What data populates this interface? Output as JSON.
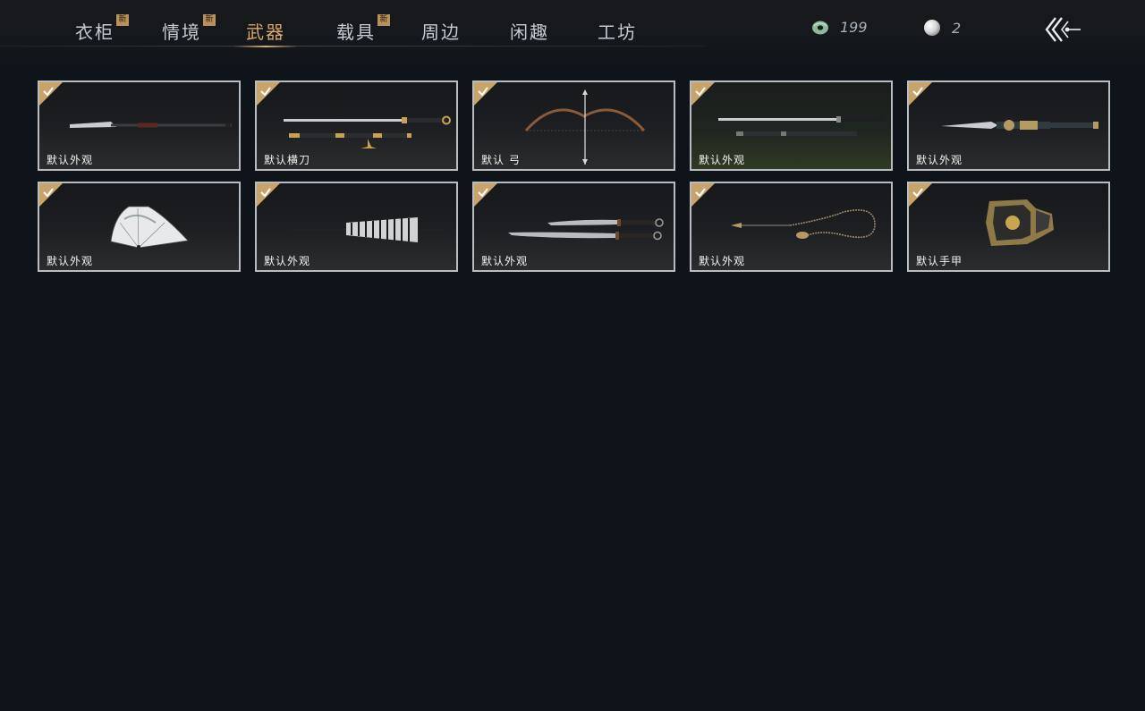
{
  "tabs": [
    {
      "label": "衣柜",
      "badge": "新"
    },
    {
      "label": "情境",
      "badge": "新"
    },
    {
      "label": "武器",
      "badge": ""
    },
    {
      "label": "载具",
      "badge": "新"
    },
    {
      "label": "周边",
      "badge": ""
    },
    {
      "label": "闲趣",
      "badge": ""
    },
    {
      "label": "工坊",
      "badge": ""
    }
  ],
  "active_tab": "武器",
  "currency": {
    "jade": {
      "icon": "jade-coin-icon",
      "value": "199"
    },
    "pearl": {
      "icon": "pearl-icon",
      "value": "2"
    }
  },
  "back_icon": "back-arrow-icon",
  "items": [
    {
      "label": "默认外观",
      "icon": "spear-icon",
      "equipped": true
    },
    {
      "label": "默认横刀",
      "icon": "hengdao-sword-icon",
      "equipped": true
    },
    {
      "label": "默认 弓",
      "icon": "bow-icon",
      "equipped": true
    },
    {
      "label": "默认外观",
      "icon": "twin-swords-icon",
      "equipped": true
    },
    {
      "label": "默认外观",
      "icon": "mo-blade-icon",
      "equipped": true
    },
    {
      "label": "默认外观",
      "icon": "folding-fan-icon",
      "equipped": true
    },
    {
      "label": "默认外观",
      "icon": "umbrella-icon",
      "equipped": true
    },
    {
      "label": "默认外观",
      "icon": "dual-blades-icon",
      "equipped": true
    },
    {
      "label": "默认外观",
      "icon": "rope-dart-icon",
      "equipped": true
    },
    {
      "label": "默认手甲",
      "icon": "gauntlet-icon",
      "equipped": true
    }
  ],
  "colors": {
    "accent": "#d6a66a",
    "badge": "#b8925a",
    "check": "#c9a46a",
    "background": "#0f131a"
  }
}
